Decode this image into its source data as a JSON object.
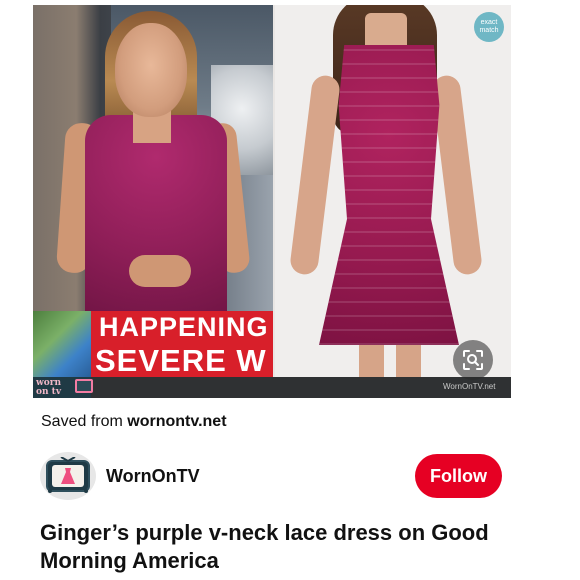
{
  "pin_image": {
    "exact_match_label": "exact match",
    "lower_third_line1": "HAPPENING",
    "lower_third_line2": "SEVERE W",
    "logo_text_line1": "worn",
    "logo_text_line2": "on tv",
    "watermark": "WornOnTV.net",
    "dress_color": "#9a1b55",
    "accent_red": "#d81f2a"
  },
  "source": {
    "prefix": "Saved from",
    "domain": "wornontv.net"
  },
  "creator": {
    "avatar_icon": "dress-tv-icon",
    "name": "WornOnTV",
    "follow_label": "Follow",
    "follow_color": "#e60023"
  },
  "pin": {
    "title": "Ginger’s purple v-neck lace dress on Good Morning America"
  },
  "icons": {
    "visual_search": "lens-icon"
  }
}
